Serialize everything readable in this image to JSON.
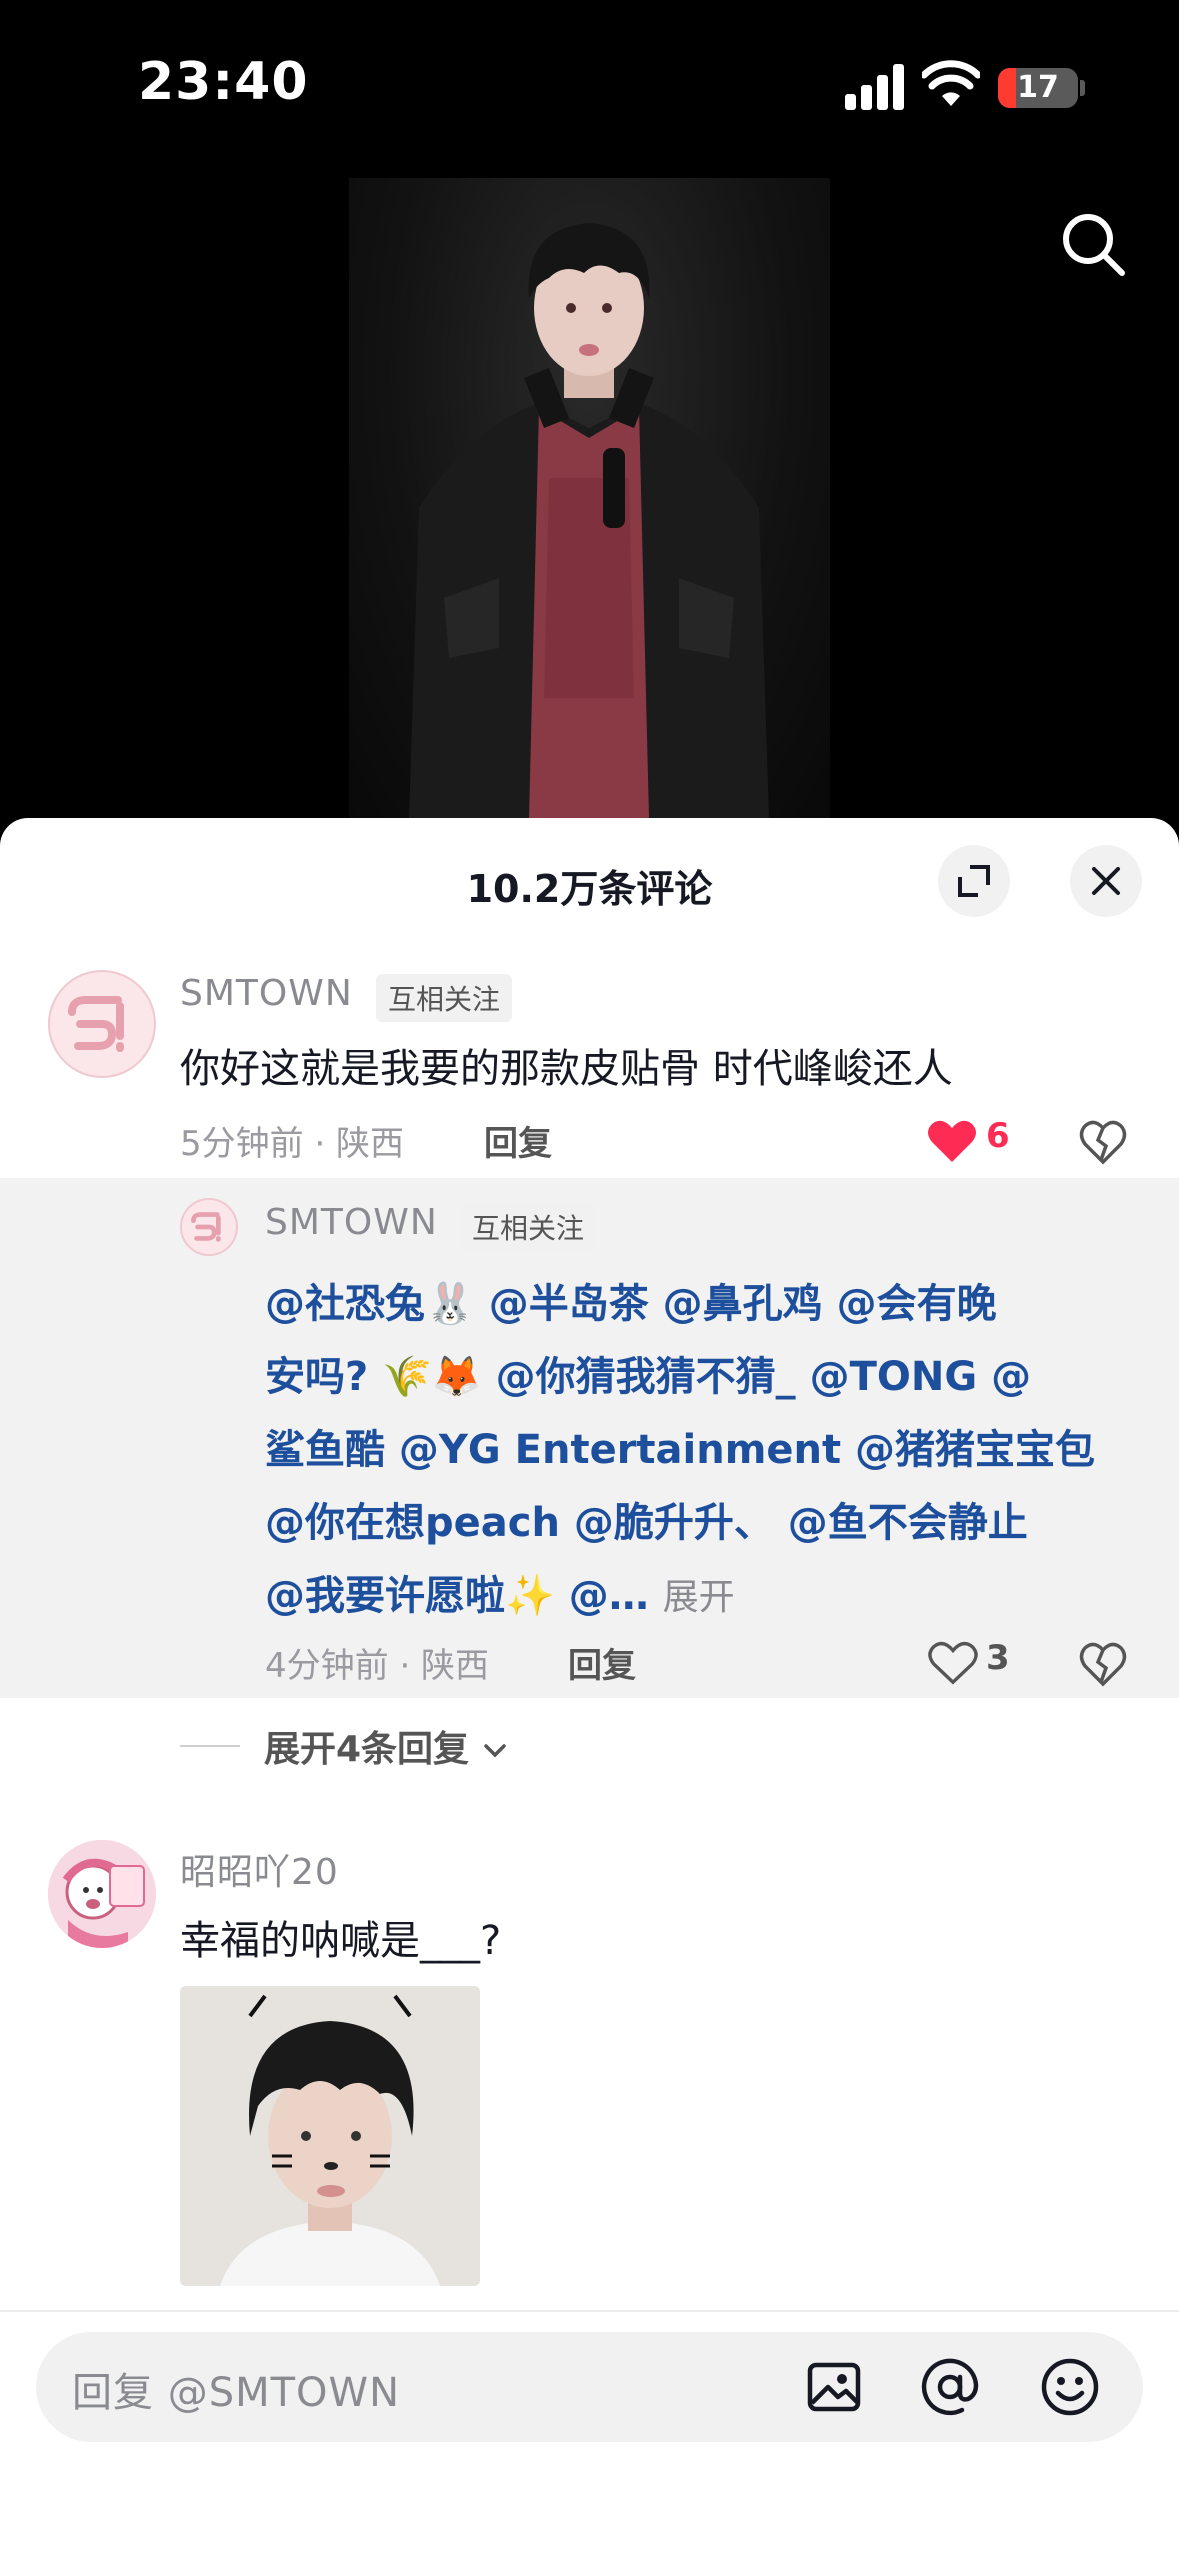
{
  "status": {
    "time": "23:40",
    "battery": "17",
    "battery_level": 0.17
  },
  "sheet": {
    "title": "10.2万条评论"
  },
  "comments": [
    {
      "username": "SMTOWN",
      "tag": "互相关注",
      "text": "你好这就是我要的那款皮贴骨 时代峰峻还人",
      "time_location": "5分钟前 · 陕西",
      "reply_label": "回复",
      "likes": "6",
      "liked": true
    },
    {
      "username": "昭昭吖20",
      "text": "幸福的呐喊是___?"
    }
  ],
  "reply": {
    "username": "SMTOWN",
    "tag": "互相关注",
    "mention_lines": [
      "@社恐兔🐰 @半岛茶 @鼻孔鸡 @会有晚",
      "安吗? 🌾🦊 @你猜我猜不猜_ @TONG @",
      "鲨鱼酷 @YG Entertainment @猪猪宝宝包",
      "@你在想peach @脆升升、 @鱼不会静止",
      "@我要许愿啦✨ @…"
    ],
    "more_label": "展开",
    "time_location": "4分钟前 · 陕西",
    "reply_label": "回复",
    "likes": "3"
  },
  "expand_replies": "展开4条回复",
  "input": {
    "placeholder": "回复 @SMTOWN"
  },
  "colors": {
    "accent_red": "#fe2c55",
    "mention_blue": "#1d4f9c"
  },
  "icons": [
    "search-icon",
    "expand-icon",
    "close-icon",
    "heart-icon",
    "dislike-icon",
    "image-icon",
    "at-icon",
    "emoji-icon",
    "chevron-down-icon"
  ]
}
